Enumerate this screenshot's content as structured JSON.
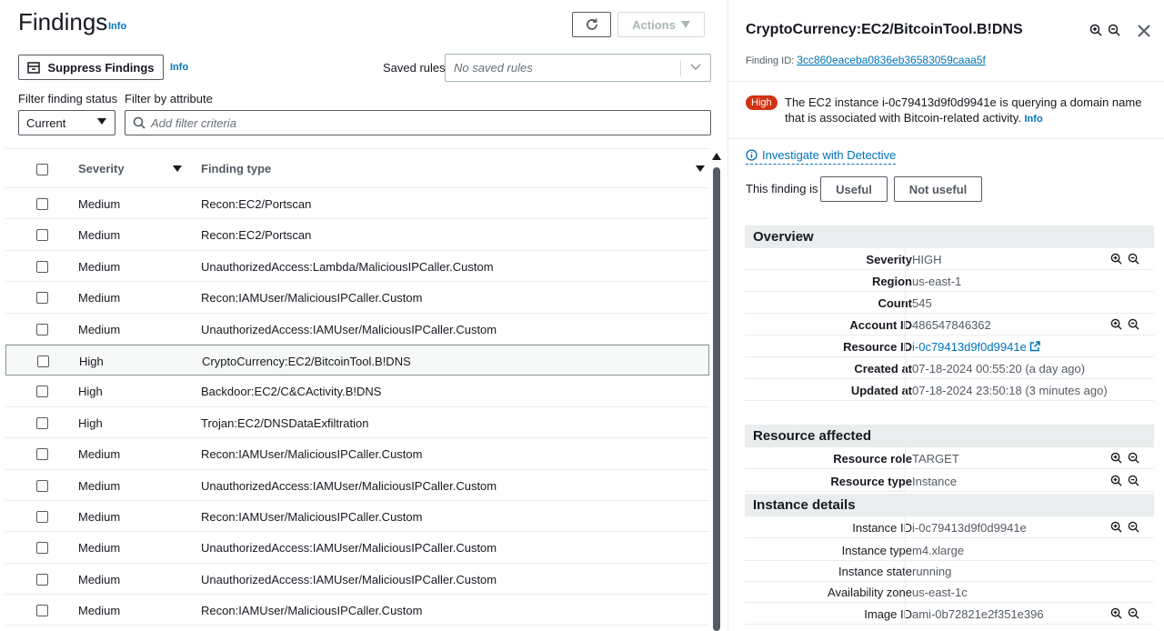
{
  "header": {
    "title": "Findings",
    "info": "Info",
    "actions_label": "Actions"
  },
  "toolbar": {
    "suppress_label": "Suppress Findings",
    "suppress_info": "Info",
    "saved_rules_label": "Saved rules",
    "saved_rules_placeholder": "No saved rules"
  },
  "filters": {
    "status_label": "Filter finding status",
    "status_value": "Current",
    "attribute_label": "Filter by attribute",
    "attribute_placeholder": "Add filter criteria"
  },
  "table": {
    "columns": [
      "Severity",
      "Finding type"
    ],
    "rows": [
      {
        "severity": "Medium",
        "type": "Recon:EC2/Portscan"
      },
      {
        "severity": "Medium",
        "type": "Recon:EC2/Portscan"
      },
      {
        "severity": "Medium",
        "type": "UnauthorizedAccess:Lambda/MaliciousIPCaller.Custom"
      },
      {
        "severity": "Medium",
        "type": "Recon:IAMUser/MaliciousIPCaller.Custom"
      },
      {
        "severity": "Medium",
        "type": "UnauthorizedAccess:IAMUser/MaliciousIPCaller.Custom"
      },
      {
        "severity": "High",
        "type": "CryptoCurrency:EC2/BitcoinTool.B!DNS"
      },
      {
        "severity": "High",
        "type": "Backdoor:EC2/C&CActivity.B!DNS"
      },
      {
        "severity": "High",
        "type": "Trojan:EC2/DNSDataExfiltration"
      },
      {
        "severity": "Medium",
        "type": "Recon:IAMUser/MaliciousIPCaller.Custom"
      },
      {
        "severity": "Medium",
        "type": "UnauthorizedAccess:IAMUser/MaliciousIPCaller.Custom"
      },
      {
        "severity": "Medium",
        "type": "Recon:IAMUser/MaliciousIPCaller.Custom"
      },
      {
        "severity": "Medium",
        "type": "UnauthorizedAccess:IAMUser/MaliciousIPCaller.Custom"
      },
      {
        "severity": "Medium",
        "type": "UnauthorizedAccess:IAMUser/MaliciousIPCaller.Custom"
      },
      {
        "severity": "Medium",
        "type": "Recon:IAMUser/MaliciousIPCaller.Custom"
      }
    ]
  },
  "detail": {
    "title": "CryptoCurrency:EC2/BitcoinTool.B!DNS",
    "finding_id_label": "Finding ID:",
    "finding_id": "3cc860eaceba0836eb36583059caaa5f",
    "severity_badge": "High",
    "description": "The EC2 instance i-0c79413d9f0d9941e is querying a domain name that is associated with Bitcoin-related activity.",
    "description_info": "Info",
    "investigate": "Investigate with Detective",
    "feedback_label": "This finding is",
    "useful": "Useful",
    "not_useful": "Not useful",
    "overview": {
      "heading": "Overview",
      "severity_k": "Severity",
      "severity_v": "HIGH",
      "region_k": "Region",
      "region_v": "us-east-1",
      "count_k": "Count",
      "count_v": "545",
      "account_k": "Account ID",
      "account_v": "486547846362",
      "resource_k": "Resource ID",
      "resource_v": "i-0c79413d9f0d9941e",
      "created_k": "Created at",
      "created_v": "07-18-2024 00:55:20 (a day ago)",
      "updated_k": "Updated at",
      "updated_v": "07-18-2024 23:50:18 (3 minutes ago)"
    },
    "resource": {
      "heading": "Resource affected",
      "role_k": "Resource role",
      "role_v": "TARGET",
      "type_k": "Resource type",
      "type_v": "Instance"
    },
    "instance": {
      "heading": "Instance details",
      "id_k": "Instance ID",
      "id_v": "i-0c79413d9f0d9941e",
      "itype_k": "Instance type",
      "itype_v": "m4.xlarge",
      "state_k": "Instance state",
      "state_v": "running",
      "az_k": "Availability zone",
      "az_v": "us-east-1c",
      "image_k": "Image ID",
      "image_v": "ami-0b72821e2f351e396"
    }
  },
  "colors": {
    "link": "#0073bb",
    "high_badge": "#d13212",
    "section_bg": "#eaeded"
  }
}
